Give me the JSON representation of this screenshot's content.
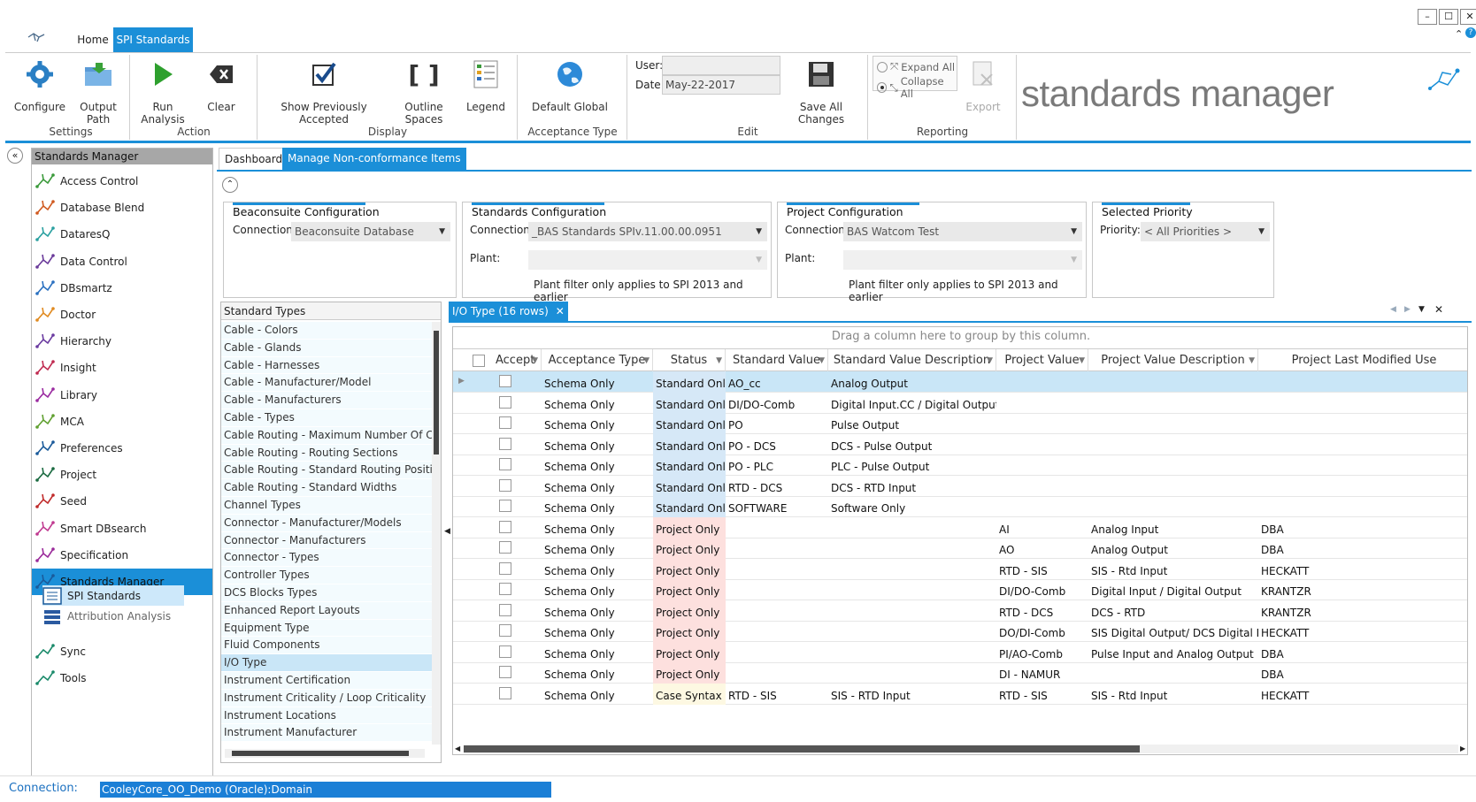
{
  "window": {
    "min": "–",
    "max": "☐",
    "close": "✕"
  },
  "tabs": {
    "home": "Home",
    "spi": "SPI Standards"
  },
  "ribbon": {
    "settings": {
      "label": "Settings",
      "configure": "Configure",
      "output_path": "Output Path"
    },
    "action": {
      "label": "Action",
      "run": "Run Analysis",
      "clear": "Clear"
    },
    "display": {
      "label": "Display",
      "show_prev": "Show Previously Accepted",
      "outline": "Outline Spaces",
      "legend": "Legend"
    },
    "acceptance": {
      "label": "Acceptance Type",
      "default_global": "Default Global"
    },
    "edit": {
      "label": "Edit",
      "user_label": "User:",
      "user_value": "",
      "date_label": "Date:",
      "date_value": "May-22-2017",
      "save_all": "Save All Changes"
    },
    "reporting": {
      "label": "Reporting",
      "expand_all": "Expand All",
      "collapse_all": "Collapse All",
      "export": "Export"
    },
    "brand": "standards manager"
  },
  "nav": {
    "header": "Standards Manager",
    "items": [
      "Access Control",
      "Database Blend",
      "DataresQ",
      "Data Control",
      "DBsmartz",
      "Doctor",
      "Hierarchy",
      "Insight",
      "Library",
      "MCA",
      "Preferences",
      "Project",
      "Seed",
      "Smart DBsearch",
      "Specification",
      "Standards Manager"
    ],
    "sub_items": [
      "SPI Standards",
      "Attribution Analysis"
    ],
    "bottom_items": [
      "Sync",
      "Tools"
    ]
  },
  "main_tabs": {
    "dashboard": "Dashboard",
    "manage": "Manage Non-conformance Items"
  },
  "config": {
    "beacon": {
      "title": "Beaconsuite Configuration",
      "conn_label": "Connection:",
      "conn_value": "Beaconsuite Database"
    },
    "standards": {
      "title": "Standards Configuration",
      "conn_label": "Connection:",
      "conn_value": "_BAS   Standards SPIv.11.00.00.0951",
      "plant_label": "Plant:",
      "note": "Plant filter only applies to SPI 2013 and earlier"
    },
    "project": {
      "title": "Project Configuration",
      "conn_label": "Connection:",
      "conn_value": "BAS     Watcom Test",
      "plant_label": "Plant:",
      "note": "Plant filter only applies to SPI 2013 and earlier"
    },
    "priority": {
      "title": "Selected Priority",
      "label": "Priority:",
      "value": "< All Priorities >"
    }
  },
  "standard_types": {
    "header": "Standard Types",
    "items": [
      "Cable - Colors",
      "Cable - Glands",
      "Cable - Harnesses",
      "Cable - Manufacturer/Model",
      "Cable - Manufacturers",
      "Cable - Types",
      "Cable Routing - Maximum Number Of Cable",
      "Cable Routing - Routing Sections",
      "Cable Routing - Standard Routing Positions",
      "Cable Routing - Standard Widths",
      "Channel Types",
      "Connector - Manufacturer/Models",
      "Connector - Manufacturers",
      "Connector - Types",
      "Controller Types",
      "DCS Blocks Types",
      "Enhanced Report Layouts",
      "Equipment Type",
      "Fluid Components",
      "I/O Type",
      "Instrument Certification",
      "Instrument Criticality / Loop Criticality",
      "Instrument Locations",
      "Instrument Manufacturer"
    ]
  },
  "grid": {
    "tab_label": "I/O Type (16 rows)",
    "group_hint": "Drag a column here to group by this column.",
    "columns": [
      "Accept",
      "Acceptance Type",
      "Status",
      "Standard Value",
      "Standard Value Description",
      "Project Value",
      "Project Value Description",
      "Project Last Modified Use"
    ],
    "rows": [
      [
        "",
        "Schema Only",
        "Standard Only",
        "AO_cc",
        "Analog Output",
        "",
        "",
        ""
      ],
      [
        "",
        "Schema Only",
        "Standard Only",
        "DI/DO-Comb",
        "Digital Input.CC / Digital Output AI",
        "",
        "",
        ""
      ],
      [
        "",
        "Schema Only",
        "Standard Only",
        "PO",
        "Pulse Output",
        "",
        "",
        ""
      ],
      [
        "",
        "Schema Only",
        "Standard Only",
        "PO - DCS",
        "DCS - Pulse Output",
        "",
        "",
        ""
      ],
      [
        "",
        "Schema Only",
        "Standard Only",
        "PO - PLC",
        "PLC - Pulse Output",
        "",
        "",
        ""
      ],
      [
        "",
        "Schema Only",
        "Standard Only",
        "RTD - DCS",
        "DCS - RTD Input",
        "",
        "",
        ""
      ],
      [
        "",
        "Schema Only",
        "Standard Only",
        "SOFTWARE",
        "Software Only",
        "",
        "",
        ""
      ],
      [
        "",
        "Schema Only",
        "Project Only",
        "",
        "",
        "AI",
        "Analog Input",
        "DBA"
      ],
      [
        "",
        "Schema Only",
        "Project Only",
        "",
        "",
        "AO",
        "Analog Output",
        "DBA"
      ],
      [
        "",
        "Schema Only",
        "Project Only",
        "",
        "",
        "RTD - SIS",
        "SIS - Rtd Input",
        "HECKATT"
      ],
      [
        "",
        "Schema Only",
        "Project Only",
        "",
        "",
        "DI/DO-Comb",
        "Digital Input / Digital Output",
        "KRANTZR"
      ],
      [
        "",
        "Schema Only",
        "Project Only",
        "",
        "",
        "RTD - DCS",
        "DCS - RTD",
        "KRANTZR"
      ],
      [
        "",
        "Schema Only",
        "Project Only",
        "",
        "",
        "DO/DI-Comb",
        "SIS Digital Output/ DCS Digital Input",
        "HECKATT"
      ],
      [
        "",
        "Schema Only",
        "Project Only",
        "",
        "",
        "PI/AO-Comb",
        "Pulse Input and Analog Output",
        "DBA"
      ],
      [
        "",
        "Schema Only",
        "Project Only",
        "",
        "",
        "DI - NAMUR",
        "",
        "DBA"
      ],
      [
        "",
        "Schema Only",
        "Case Syntax",
        "RTD - SIS",
        "SIS - RTD Input",
        "RTD - SIS",
        "SIS - Rtd Input",
        "HECKATT"
      ]
    ]
  },
  "status_bar": {
    "label": "Connection:",
    "value": "CooleyCore_OO_Demo (Oracle):Domain"
  },
  "colors": {
    "accent": "#1b8fd8",
    "standard_only": "#d6e8f7",
    "project_only": "#fde0de",
    "case_syntax": "#fdf8e2"
  }
}
